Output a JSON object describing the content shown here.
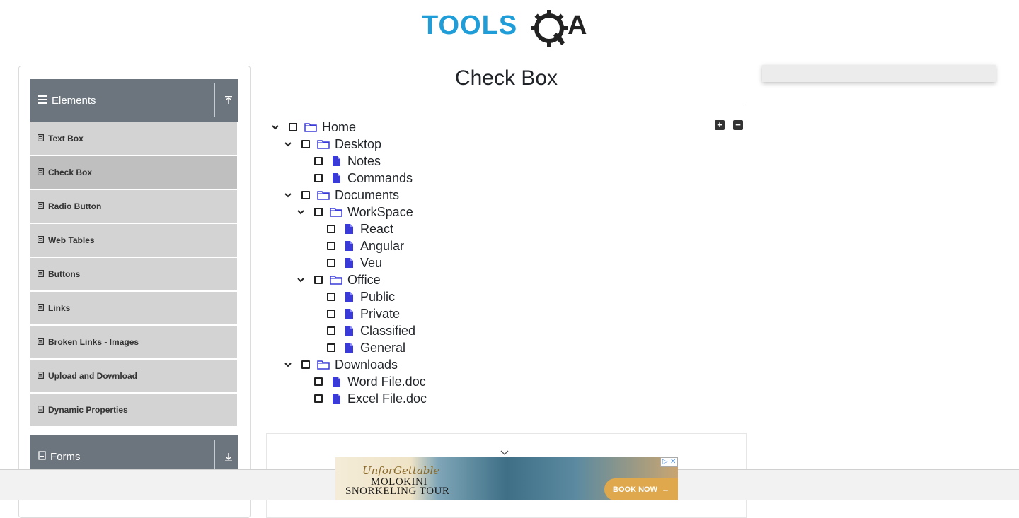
{
  "header": {
    "logo_text": "TOOLSQA"
  },
  "sidebar": {
    "elements_group": {
      "label": "Elements"
    },
    "items": [
      {
        "label": "Text Box",
        "active": false
      },
      {
        "label": "Check Box",
        "active": true
      },
      {
        "label": "Radio Button",
        "active": false
      },
      {
        "label": "Web Tables",
        "active": false
      },
      {
        "label": "Buttons",
        "active": false
      },
      {
        "label": "Links",
        "active": false
      },
      {
        "label": "Broken Links - Images",
        "active": false
      },
      {
        "label": "Upload and Download",
        "active": false
      },
      {
        "label": "Dynamic Properties",
        "active": false
      }
    ],
    "forms_group": {
      "label": "Forms"
    }
  },
  "main": {
    "title": "Check Box",
    "expand_all_icon": "plus-square-icon",
    "collapse_all_icon": "minus-square-icon",
    "tree": [
      {
        "label": "Home",
        "type": "folder",
        "depth": 0,
        "expanded": true
      },
      {
        "label": "Desktop",
        "type": "folder",
        "depth": 1,
        "expanded": true
      },
      {
        "label": "Notes",
        "type": "file",
        "depth": 2
      },
      {
        "label": "Commands",
        "type": "file",
        "depth": 2
      },
      {
        "label": "Documents",
        "type": "folder",
        "depth": 1,
        "expanded": true
      },
      {
        "label": "WorkSpace",
        "type": "folder",
        "depth": 2,
        "expanded": true
      },
      {
        "label": "React",
        "type": "file",
        "depth": 3
      },
      {
        "label": "Angular",
        "type": "file",
        "depth": 3
      },
      {
        "label": "Veu",
        "type": "file",
        "depth": 3
      },
      {
        "label": "Office",
        "type": "folder",
        "depth": 2,
        "expanded": true
      },
      {
        "label": "Public",
        "type": "file",
        "depth": 3
      },
      {
        "label": "Private",
        "type": "file",
        "depth": 3
      },
      {
        "label": "Classified",
        "type": "file",
        "depth": 3
      },
      {
        "label": "General",
        "type": "file",
        "depth": 3
      },
      {
        "label": "Downloads",
        "type": "folder",
        "depth": 1,
        "expanded": true
      },
      {
        "label": "Word File.doc",
        "type": "file",
        "depth": 2
      },
      {
        "label": "Excel File.doc",
        "type": "file",
        "depth": 2
      }
    ]
  },
  "ad": {
    "line1": "UnforGettable",
    "line2": "MOLOKINI",
    "line3": "SNORKELING TOUR",
    "cta": "BOOK NOW"
  },
  "colors": {
    "brand_blue": "#1e9dd9",
    "sidebar_header": "#6c757d",
    "menu_item": "#d3d3d3",
    "icon_blue": "#3a3ad8"
  }
}
